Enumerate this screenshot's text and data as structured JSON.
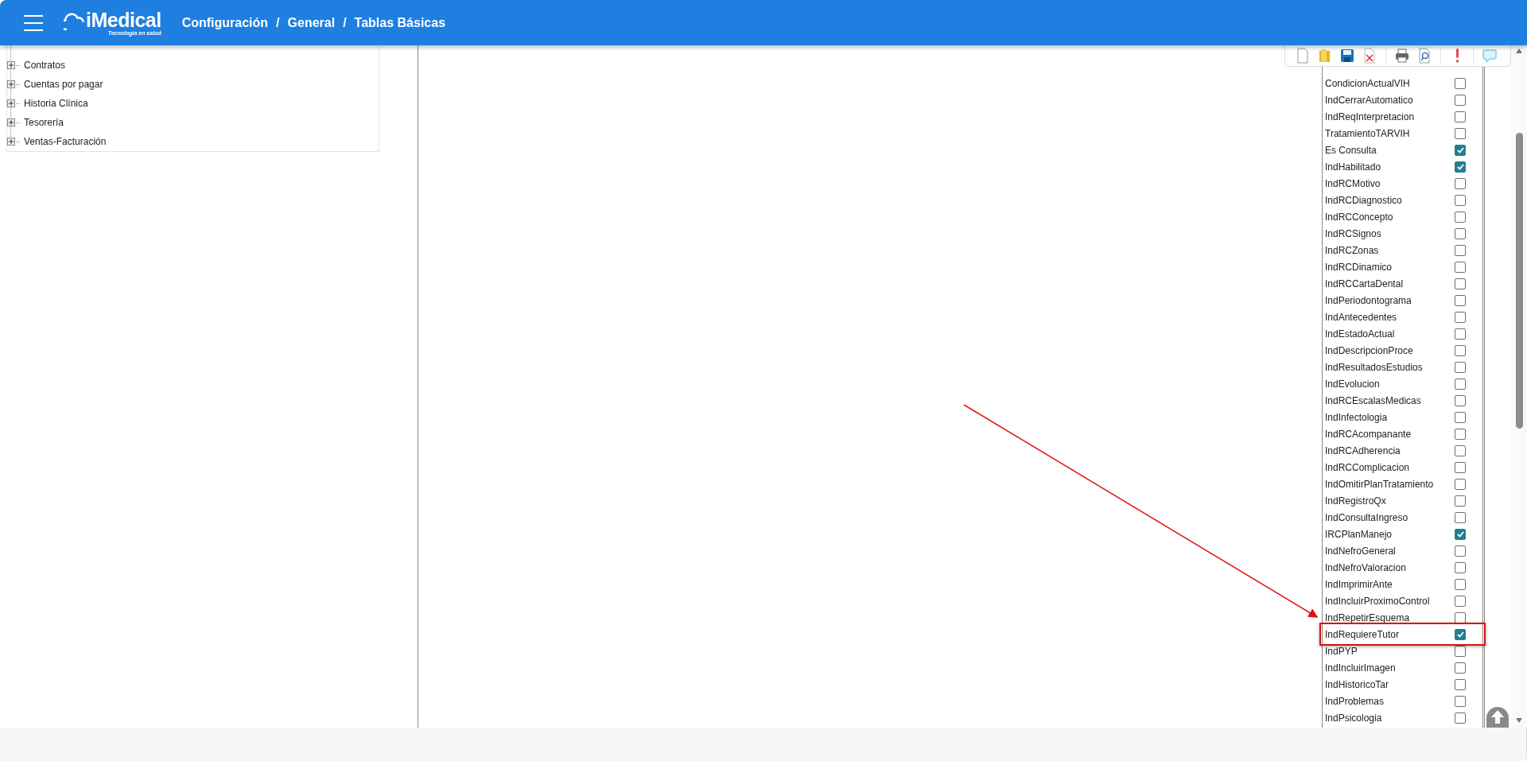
{
  "header": {
    "logo": {
      "name": "iMedical",
      "tagline": "Tecnología en salud"
    },
    "breadcrumb": [
      "Configuración",
      "General",
      "Tablas Básicas"
    ],
    "separator": "/"
  },
  "tree": [
    {
      "label": "Contratos",
      "expanded": false
    },
    {
      "label": "Cuentas por pagar",
      "expanded": false
    },
    {
      "label": "Historia Clínica",
      "expanded": false
    },
    {
      "label": "Tesorería",
      "expanded": false
    },
    {
      "label": "Ventas-Facturación",
      "expanded": false
    }
  ],
  "fields": [
    {
      "label": "CondicionActualVIH",
      "checked": false,
      "highlighted": false
    },
    {
      "label": "IndCerrarAutomatico",
      "checked": false,
      "highlighted": false
    },
    {
      "label": "IndReqInterpretacion",
      "checked": false,
      "highlighted": false
    },
    {
      "label": "TratamientoTARVIH",
      "checked": false,
      "highlighted": false
    },
    {
      "label": "Es Consulta",
      "checked": true,
      "highlighted": false
    },
    {
      "label": "IndHabilitado",
      "checked": true,
      "highlighted": false
    },
    {
      "label": "IndRCMotivo",
      "checked": false,
      "highlighted": false
    },
    {
      "label": "IndRCDiagnostico",
      "checked": false,
      "highlighted": false
    },
    {
      "label": "IndRCConcepto",
      "checked": false,
      "highlighted": false
    },
    {
      "label": "IndRCSignos",
      "checked": false,
      "highlighted": false
    },
    {
      "label": "IndRCZonas",
      "checked": false,
      "highlighted": false
    },
    {
      "label": "IndRCDinamico",
      "checked": false,
      "highlighted": false
    },
    {
      "label": "IndRCCartaDental",
      "checked": false,
      "highlighted": false
    },
    {
      "label": "IndPeriodontograma",
      "checked": false,
      "highlighted": false
    },
    {
      "label": "IndAntecedentes",
      "checked": false,
      "highlighted": false
    },
    {
      "label": "IndEstadoActual",
      "checked": false,
      "highlighted": false
    },
    {
      "label": "IndDescripcionProce",
      "checked": false,
      "highlighted": false
    },
    {
      "label": "IndResultadosEstudios",
      "checked": false,
      "highlighted": false
    },
    {
      "label": "IndEvolucion",
      "checked": false,
      "highlighted": false
    },
    {
      "label": "IndRCEscalasMedicas",
      "checked": false,
      "highlighted": false
    },
    {
      "label": "IndInfectologia",
      "checked": false,
      "highlighted": false
    },
    {
      "label": "IndRCAcompanante",
      "checked": false,
      "highlighted": false
    },
    {
      "label": "IndRCAdherencia",
      "checked": false,
      "highlighted": false
    },
    {
      "label": "IndRCComplicacion",
      "checked": false,
      "highlighted": false
    },
    {
      "label": "IndOmitirPlanTratamiento",
      "checked": false,
      "highlighted": false
    },
    {
      "label": "IndRegistroQx",
      "checked": false,
      "highlighted": false
    },
    {
      "label": "IndConsultaIngreso",
      "checked": false,
      "highlighted": false
    },
    {
      "label": "IRCPlanManejo",
      "checked": true,
      "highlighted": false
    },
    {
      "label": "IndNefroGeneral",
      "checked": false,
      "highlighted": false
    },
    {
      "label": "IndNefroValoracion",
      "checked": false,
      "highlighted": false
    },
    {
      "label": "IndImprimirAnte",
      "checked": false,
      "highlighted": false
    },
    {
      "label": "IndIncluirProximoControl",
      "checked": false,
      "highlighted": false
    },
    {
      "label": "IndRepetirEsquema",
      "checked": false,
      "highlighted": false
    },
    {
      "label": "IndRequiereTutor",
      "checked": true,
      "highlighted": true
    },
    {
      "label": "IndPYP",
      "checked": false,
      "highlighted": false
    },
    {
      "label": "IndIncluirImagen",
      "checked": false,
      "highlighted": false
    },
    {
      "label": "IndHistoricoTar",
      "checked": false,
      "highlighted": false
    },
    {
      "label": "IndProblemas",
      "checked": false,
      "highlighted": false
    },
    {
      "label": "IndPsicologia",
      "checked": false,
      "highlighted": false
    }
  ]
}
